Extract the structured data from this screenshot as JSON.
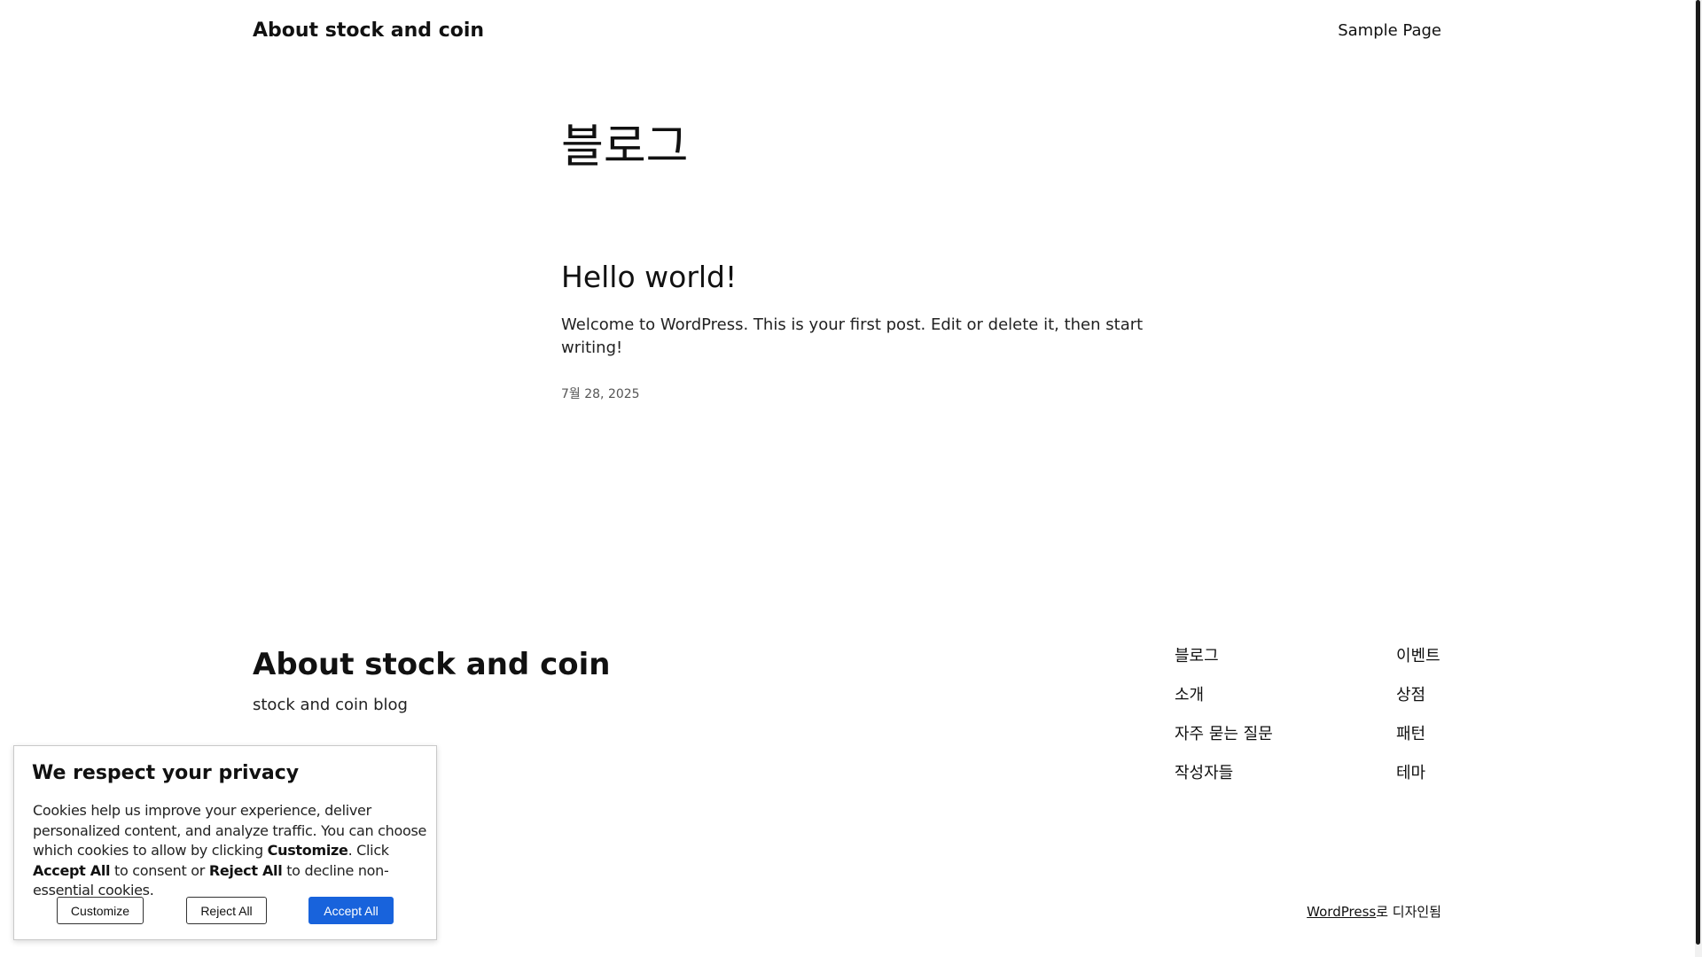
{
  "header": {
    "site_title": "About stock and coin",
    "nav": {
      "sample_page": "Sample Page"
    }
  },
  "main": {
    "page_title": "블로그",
    "post": {
      "title": "Hello world!",
      "excerpt": "Welcome to WordPress. This is your first post. Edit or delete it, then start writing!",
      "date": "7월 28, 2025"
    }
  },
  "footer": {
    "title": "About stock and coin",
    "tagline": "stock and coin blog",
    "nav_col1": [
      "블로그",
      "소개",
      "자주 묻는 질문",
      "작성자들"
    ],
    "nav_col2": [
      "이벤트",
      "상점",
      "패턴",
      "테마"
    ],
    "credit_link": "WordPress",
    "credit_suffix": "로 디자인됨"
  },
  "cookie_banner": {
    "title": "We respect your privacy",
    "text_1": "Cookies help us improve your experience, deliver personalized content, and analyze traffic. You can choose which cookies to allow by clicking ",
    "text_customize": "Customize",
    "text_2": ". Click ",
    "text_accept": "Accept All",
    "text_3": " to consent or ",
    "text_reject": "Reject All",
    "text_4": " to decline non-essential cookies.",
    "customize_button": "Customize",
    "reject_button": "Reject All",
    "accept_button": "Accept All",
    "accent_color": "#1863dc"
  }
}
